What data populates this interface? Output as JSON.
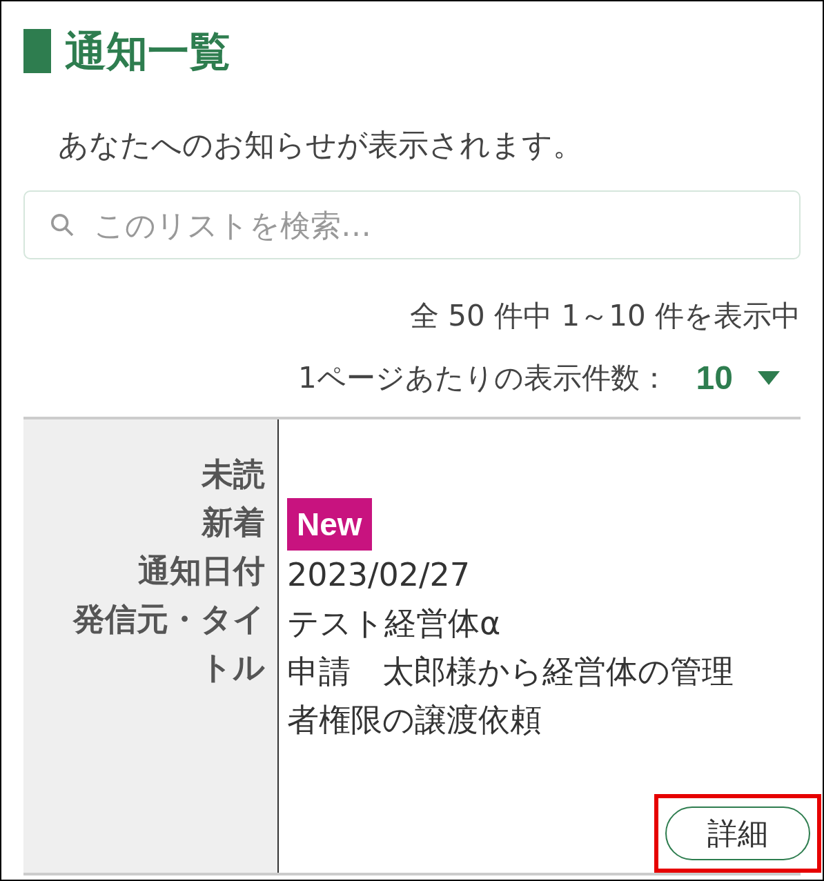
{
  "title": "通知一覧",
  "description": "あなたへのお知らせが表示されます。",
  "search": {
    "placeholder": "このリストを検索…"
  },
  "count_text": "全 50 件中 1～10 件を表示中",
  "per_page": {
    "label": "1ページあたりの表示件数：",
    "value": "10"
  },
  "notification": {
    "fields": [
      {
        "kind": "empty",
        "label": "未読"
      },
      {
        "kind": "badge",
        "label": "新着",
        "badge": "New"
      },
      {
        "kind": "text",
        "label": "通知日付",
        "value": "2023/02/27"
      },
      {
        "kind": "lines",
        "label": "発信元・タイトル",
        "lines": [
          "テスト経営体α",
          "申請　太郎様から経営体の管理者権限の譲渡依頼"
        ]
      }
    ],
    "detail_button": {
      "label": "詳細",
      "highlighted": true
    }
  }
}
